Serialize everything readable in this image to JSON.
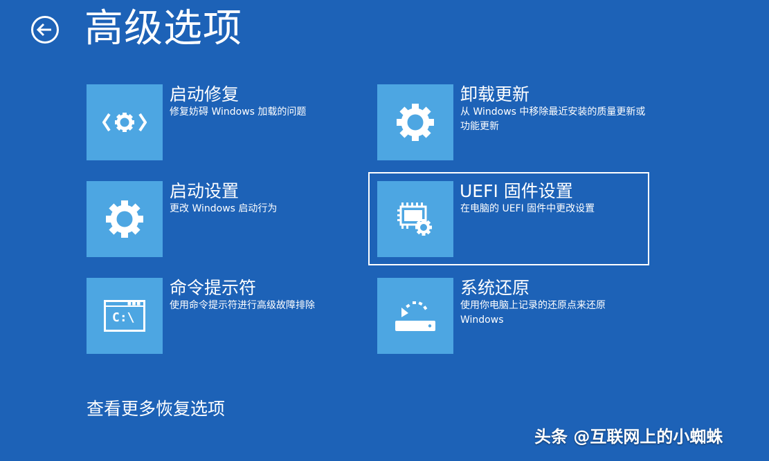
{
  "header": {
    "title": "高级选项",
    "back_icon": "back-arrow-icon"
  },
  "options": [
    {
      "title": "启动修复",
      "description": "修复妨碍 Windows 加载的问题",
      "icon": "startup-repair-icon"
    },
    {
      "title": "卸载更新",
      "description": "从 Windows 中移除最近安装的质量更新或功能更新",
      "icon": "gear-icon"
    },
    {
      "title": "启动设置",
      "description": "更改 Windows 启动行为",
      "icon": "gear-icon"
    },
    {
      "title": "UEFI 固件设置",
      "description": "在电脑的 UEFI 固件中更改设置",
      "icon": "chip-gear-icon",
      "selected": true
    },
    {
      "title": "命令提示符",
      "description": "使用命令提示符进行高级故障排除",
      "icon": "command-prompt-icon",
      "icon_text": "C:\\"
    },
    {
      "title": "系统还原",
      "description": "使用你电脑上记录的还原点来还原 Windows",
      "icon": "system-restore-icon"
    }
  ],
  "footer": {
    "more_options": "查看更多恢复选项"
  },
  "watermark": {
    "text": "头条 @互联网上的小蜘蛛"
  },
  "colors": {
    "background": "#1d62b7",
    "tile": "#4da6e2",
    "text": "#ffffff"
  }
}
